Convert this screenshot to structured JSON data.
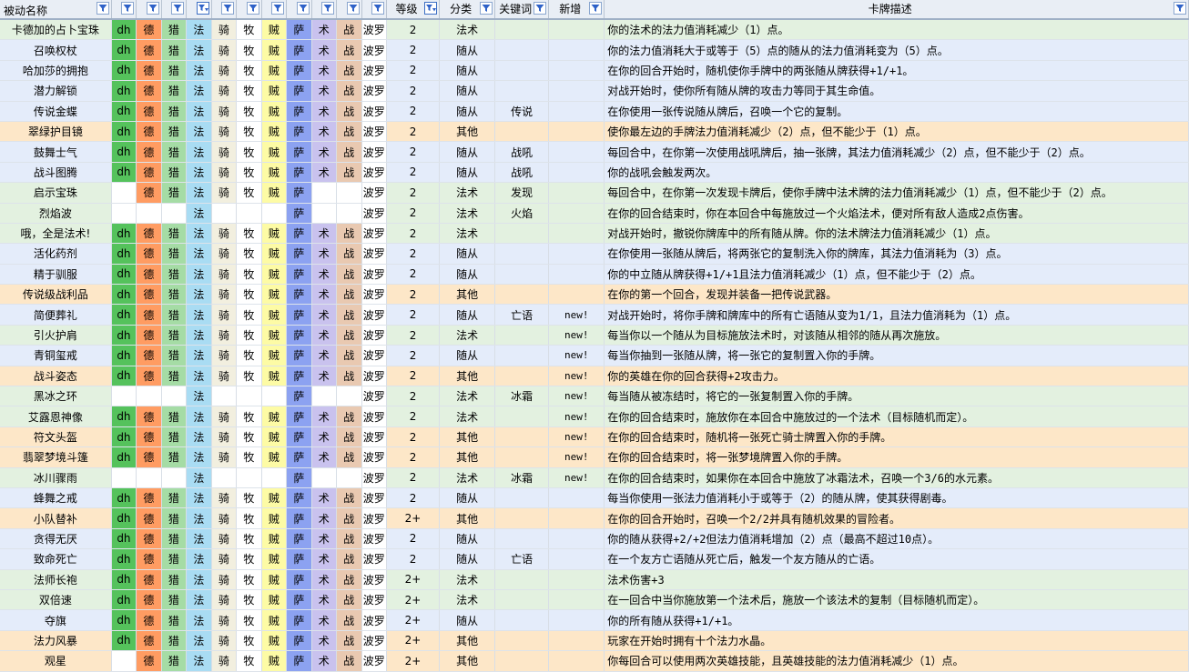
{
  "headers": [
    "被动名称",
    "",
    "",
    "",
    "",
    "",
    "",
    "",
    "",
    "",
    "",
    "",
    "等级",
    "分类",
    "关键词",
    "新增",
    "卡牌描述"
  ],
  "class_colors": {
    "dh": {
      "bg": "#55c25c",
      "fg": "#000000"
    },
    "druid": {
      "bg": "#ff9c62",
      "fg": "#000000"
    },
    "hunter": {
      "bg": "#a5dca5",
      "fg": "#000000"
    },
    "mage": {
      "bg": "#a9dcf3",
      "fg": "#000000"
    },
    "paladin": {
      "bg": "#f2efdf",
      "fg": "#000000"
    },
    "priest": {
      "bg": "#ffffff",
      "fg": "#000000"
    },
    "rogue": {
      "bg": "#fdfba5",
      "fg": "#000000"
    },
    "shaman": {
      "bg": "#8ca2f1",
      "fg": "#000000"
    },
    "warlock": {
      "bg": "#c9c2ee",
      "fg": "#000000"
    },
    "warrior": {
      "bg": "#e9c9b1",
      "fg": "#000000"
    },
    "blank": {
      "bg": "#ffffff",
      "fg": "#000000"
    }
  },
  "row_palette": {
    "green": "#e3f1e0",
    "blue": "#e4ecfa",
    "orange": "#fde7c8"
  },
  "rows": [
    {
      "name": "卡德加的占卜宝珠",
      "tint": "green",
      "cls": [
        "dh",
        "德",
        "猎",
        "法",
        "骑",
        "牧",
        "贼",
        "萨",
        "术",
        "战",
        "波罗"
      ],
      "level": "2",
      "type": "法术",
      "kw": "",
      "new": "",
      "desc": "你的法术的法力值消耗减少（1）点。"
    },
    {
      "name": "召唤权杖",
      "tint": "blue",
      "cls": [
        "dh",
        "德",
        "猎",
        "法",
        "骑",
        "牧",
        "贼",
        "萨",
        "术",
        "战",
        "波罗"
      ],
      "level": "2",
      "type": "随从",
      "kw": "",
      "new": "",
      "desc": "你的法力值消耗大于或等于（5）点的随从的法力值消耗变为（5）点。"
    },
    {
      "name": "哈加莎的拥抱",
      "tint": "blue",
      "cls": [
        "dh",
        "德",
        "猎",
        "法",
        "骑",
        "牧",
        "贼",
        "萨",
        "术",
        "战",
        "波罗"
      ],
      "level": "2",
      "type": "随从",
      "kw": "",
      "new": "",
      "desc": "在你的回合开始时，随机使你手牌中的两张随从牌获得+1/+1。"
    },
    {
      "name": "潜力解锁",
      "tint": "blue",
      "cls": [
        "dh",
        "德",
        "猎",
        "法",
        "骑",
        "牧",
        "贼",
        "萨",
        "术",
        "战",
        "波罗"
      ],
      "level": "2",
      "type": "随从",
      "kw": "",
      "new": "",
      "desc": "对战开始时，使你所有随从牌的攻击力等同于其生命值。"
    },
    {
      "name": "传说金蝶",
      "tint": "blue",
      "cls": [
        "dh",
        "德",
        "猎",
        "法",
        "骑",
        "牧",
        "贼",
        "萨",
        "术",
        "战",
        "波罗"
      ],
      "level": "2",
      "type": "随从",
      "kw": "传说",
      "new": "",
      "desc": "在你使用一张传说随从牌后，召唤一个它的复制。"
    },
    {
      "name": "翠绿护目镜",
      "tint": "orange",
      "cls": [
        "dh",
        "德",
        "猎",
        "法",
        "骑",
        "牧",
        "贼",
        "萨",
        "术",
        "战",
        "波罗"
      ],
      "level": "2",
      "type": "其他",
      "kw": "",
      "new": "",
      "desc": "使你最左边的手牌法力值消耗减少（2）点，但不能少于（1）点。"
    },
    {
      "name": "鼓舞士气",
      "tint": "blue",
      "cls": [
        "dh",
        "德",
        "猎",
        "法",
        "骑",
        "牧",
        "贼",
        "萨",
        "术",
        "战",
        "波罗"
      ],
      "level": "2",
      "type": "随从",
      "kw": "战吼",
      "new": "",
      "desc": "每回合中，在你第一次使用战吼牌后，抽一张牌，其法力值消耗减少（2）点，但不能少于（2）点。"
    },
    {
      "name": "战斗图腾",
      "tint": "blue",
      "cls": [
        "dh",
        "德",
        "猎",
        "法",
        "骑",
        "牧",
        "贼",
        "萨",
        "术",
        "战",
        "波罗"
      ],
      "level": "2",
      "type": "随从",
      "kw": "战吼",
      "new": "",
      "desc": "你的战吼会触发两次。"
    },
    {
      "name": "启示宝珠",
      "tint": "green",
      "cls": [
        "",
        "德",
        "猎",
        "法",
        "骑",
        "牧",
        "贼",
        "萨",
        "",
        "",
        "波罗"
      ],
      "level": "2",
      "type": "法术",
      "kw": "发现",
      "new": "",
      "desc": "每回合中，在你第一次发现卡牌后，使你手牌中法术牌的法力值消耗减少（1）点，但不能少于（2）点。"
    },
    {
      "name": "烈焰波",
      "tint": "green",
      "cls": [
        "",
        "",
        "",
        "法",
        "",
        "",
        "",
        "萨",
        "",
        "",
        "波罗"
      ],
      "level": "2",
      "type": "法术",
      "kw": "火焰",
      "new": "",
      "desc": "在你的回合结束时，你在本回合中每施放过一个火焰法术，便对所有敌人造成2点伤害。"
    },
    {
      "name": "哦，全是法术!",
      "tint": "green",
      "cls": [
        "dh",
        "德",
        "猎",
        "法",
        "骑",
        "牧",
        "贼",
        "萨",
        "术",
        "战",
        "波罗"
      ],
      "level": "2",
      "type": "法术",
      "kw": "",
      "new": "",
      "desc": "对战开始时，撤锐你牌库中的所有随从牌。你的法术牌法力值消耗减少（1）点。"
    },
    {
      "name": "活化药剂",
      "tint": "blue",
      "cls": [
        "dh",
        "德",
        "猎",
        "法",
        "骑",
        "牧",
        "贼",
        "萨",
        "术",
        "战",
        "波罗"
      ],
      "level": "2",
      "type": "随从",
      "kw": "",
      "new": "",
      "desc": "在你使用一张随从牌后，将两张它的复制洗入你的牌库，其法力值消耗为（3）点。"
    },
    {
      "name": "精于驯服",
      "tint": "blue",
      "cls": [
        "dh",
        "德",
        "猎",
        "法",
        "骑",
        "牧",
        "贼",
        "萨",
        "术",
        "战",
        "波罗"
      ],
      "level": "2",
      "type": "随从",
      "kw": "",
      "new": "",
      "desc": "你的中立随从牌获得+1/+1且法力值消耗减少（1）点，但不能少于（2）点。"
    },
    {
      "name": "传说级战利品",
      "tint": "orange",
      "cls": [
        "dh",
        "德",
        "猎",
        "法",
        "骑",
        "牧",
        "贼",
        "萨",
        "术",
        "战",
        "波罗"
      ],
      "level": "2",
      "type": "其他",
      "kw": "",
      "new": "",
      "desc": "在你的第一个回合，发现并装备一把传说武器。"
    },
    {
      "name": "简便葬礼",
      "tint": "blue",
      "cls": [
        "dh",
        "德",
        "猎",
        "法",
        "骑",
        "牧",
        "贼",
        "萨",
        "术",
        "战",
        "波罗"
      ],
      "level": "2",
      "type": "随从",
      "kw": "亡语",
      "new": "new!",
      "desc": "对战开始时，将你手牌和牌库中的所有亡语随从变为1/1，且法力值消耗为（1）点。"
    },
    {
      "name": "引火护肩",
      "tint": "green",
      "cls": [
        "dh",
        "德",
        "猎",
        "法",
        "骑",
        "牧",
        "贼",
        "萨",
        "术",
        "战",
        "波罗"
      ],
      "level": "2",
      "type": "法术",
      "kw": "",
      "new": "new!",
      "desc": "每当你以一个随从为目标施放法术时，对该随从相邻的随从再次施放。"
    },
    {
      "name": "青铜玺戒",
      "tint": "blue",
      "cls": [
        "dh",
        "德",
        "猎",
        "法",
        "骑",
        "牧",
        "贼",
        "萨",
        "术",
        "战",
        "波罗"
      ],
      "level": "2",
      "type": "随从",
      "kw": "",
      "new": "new!",
      "desc": "每当你抽到一张随从牌，将一张它的复制置入你的手牌。"
    },
    {
      "name": "战斗姿态",
      "tint": "orange",
      "cls": [
        "dh",
        "德",
        "猎",
        "法",
        "骑",
        "牧",
        "贼",
        "萨",
        "术",
        "战",
        "波罗"
      ],
      "level": "2",
      "type": "其他",
      "kw": "",
      "new": "new!",
      "desc": "你的英雄在你的回合获得+2攻击力。"
    },
    {
      "name": "黑冰之环",
      "tint": "green",
      "cls": [
        "",
        "",
        "",
        "法",
        "",
        "",
        "",
        "萨",
        "",
        "",
        "波罗"
      ],
      "level": "2",
      "type": "法术",
      "kw": "冰霜",
      "new": "new!",
      "desc": "每当随从被冻结时，将它的一张复制置入你的手牌。"
    },
    {
      "name": "艾露恩神像",
      "tint": "green",
      "cls": [
        "dh",
        "德",
        "猎",
        "法",
        "骑",
        "牧",
        "贼",
        "萨",
        "术",
        "战",
        "波罗"
      ],
      "level": "2",
      "type": "法术",
      "kw": "",
      "new": "new!",
      "desc": "在你的回合结束时，施放你在本回合中施放过的一个法术（目标随机而定）。"
    },
    {
      "name": "符文头盔",
      "tint": "orange",
      "cls": [
        "dh",
        "德",
        "猎",
        "法",
        "骑",
        "牧",
        "贼",
        "萨",
        "术",
        "战",
        "波罗"
      ],
      "level": "2",
      "type": "其他",
      "kw": "",
      "new": "new!",
      "desc": "在你的回合结束时，随机将一张死亡骑士牌置入你的手牌。"
    },
    {
      "name": "翡翠梦境斗篷",
      "tint": "orange",
      "cls": [
        "dh",
        "德",
        "猎",
        "法",
        "骑",
        "牧",
        "贼",
        "萨",
        "术",
        "战",
        "波罗"
      ],
      "level": "2",
      "type": "其他",
      "kw": "",
      "new": "new!",
      "desc": "在你的回合结束时，将一张梦境牌置入你的手牌。"
    },
    {
      "name": "冰川骤雨",
      "tint": "green",
      "cls": [
        "",
        "",
        "",
        "法",
        "",
        "",
        "",
        "萨",
        "",
        "",
        "波罗"
      ],
      "level": "2",
      "type": "法术",
      "kw": "冰霜",
      "new": "new!",
      "desc": "在你的回合结束时，如果你在本回合中施放了冰霜法术，召唤一个3/6的水元素。"
    },
    {
      "name": "蜂舞之戒",
      "tint": "blue",
      "cls": [
        "dh",
        "德",
        "猎",
        "法",
        "骑",
        "牧",
        "贼",
        "萨",
        "术",
        "战",
        "波罗"
      ],
      "level": "2",
      "type": "随从",
      "kw": "",
      "new": "",
      "desc": "每当你使用一张法力值消耗小于或等于（2）的随从牌，使其获得剧毒。"
    },
    {
      "name": "小队替补",
      "tint": "orange",
      "cls": [
        "dh",
        "德",
        "猎",
        "法",
        "骑",
        "牧",
        "贼",
        "萨",
        "术",
        "战",
        "波罗"
      ],
      "level": "2+",
      "type": "其他",
      "kw": "",
      "new": "",
      "desc": "在你的回合开始时，召唤一个2/2并具有随机效果的冒险者。"
    },
    {
      "name": "贪得无厌",
      "tint": "blue",
      "cls": [
        "dh",
        "德",
        "猎",
        "法",
        "骑",
        "牧",
        "贼",
        "萨",
        "术",
        "战",
        "波罗"
      ],
      "level": "2",
      "type": "随从",
      "kw": "",
      "new": "",
      "desc": "你的随从获得+2/+2但法力值消耗增加（2）点（最高不超过10点）。"
    },
    {
      "name": "致命死亡",
      "tint": "blue",
      "cls": [
        "dh",
        "德",
        "猎",
        "法",
        "骑",
        "牧",
        "贼",
        "萨",
        "术",
        "战",
        "波罗"
      ],
      "level": "2",
      "type": "随从",
      "kw": "亡语",
      "new": "",
      "desc": "在一个友方亡语随从死亡后，触发一个友方随从的亡语。"
    },
    {
      "name": "法师长袍",
      "tint": "green",
      "cls": [
        "dh",
        "德",
        "猎",
        "法",
        "骑",
        "牧",
        "贼",
        "萨",
        "术",
        "战",
        "波罗"
      ],
      "level": "2+",
      "type": "法术",
      "kw": "",
      "new": "",
      "desc": "法术伤害+3"
    },
    {
      "name": "双倍速",
      "tint": "green",
      "cls": [
        "dh",
        "德",
        "猎",
        "法",
        "骑",
        "牧",
        "贼",
        "萨",
        "术",
        "战",
        "波罗"
      ],
      "level": "2+",
      "type": "法术",
      "kw": "",
      "new": "",
      "desc": "在一回合中当你施放第一个法术后，施放一个该法术的复制（目标随机而定）。"
    },
    {
      "name": "夺旗",
      "tint": "blue",
      "cls": [
        "dh",
        "德",
        "猎",
        "法",
        "骑",
        "牧",
        "贼",
        "萨",
        "术",
        "战",
        "波罗"
      ],
      "level": "2+",
      "type": "随从",
      "kw": "",
      "new": "",
      "desc": "你的所有随从获得+1/+1。"
    },
    {
      "name": "法力风暴",
      "tint": "orange",
      "cls": [
        "dh",
        "德",
        "猎",
        "法",
        "骑",
        "牧",
        "贼",
        "萨",
        "术",
        "战",
        "波罗"
      ],
      "level": "2+",
      "type": "其他",
      "kw": "",
      "new": "",
      "desc": "玩家在开始时拥有十个法力水晶。"
    },
    {
      "name": "观星",
      "tint": "orange",
      "cls": [
        "",
        "德",
        "猎",
        "法",
        "骑",
        "牧",
        "贼",
        "萨",
        "术",
        "战",
        "波罗"
      ],
      "level": "2+",
      "type": "其他",
      "kw": "",
      "new": "",
      "desc": "你每回合可以使用两次英雄技能，且英雄技能的法力值消耗减少（1）点。"
    }
  ]
}
